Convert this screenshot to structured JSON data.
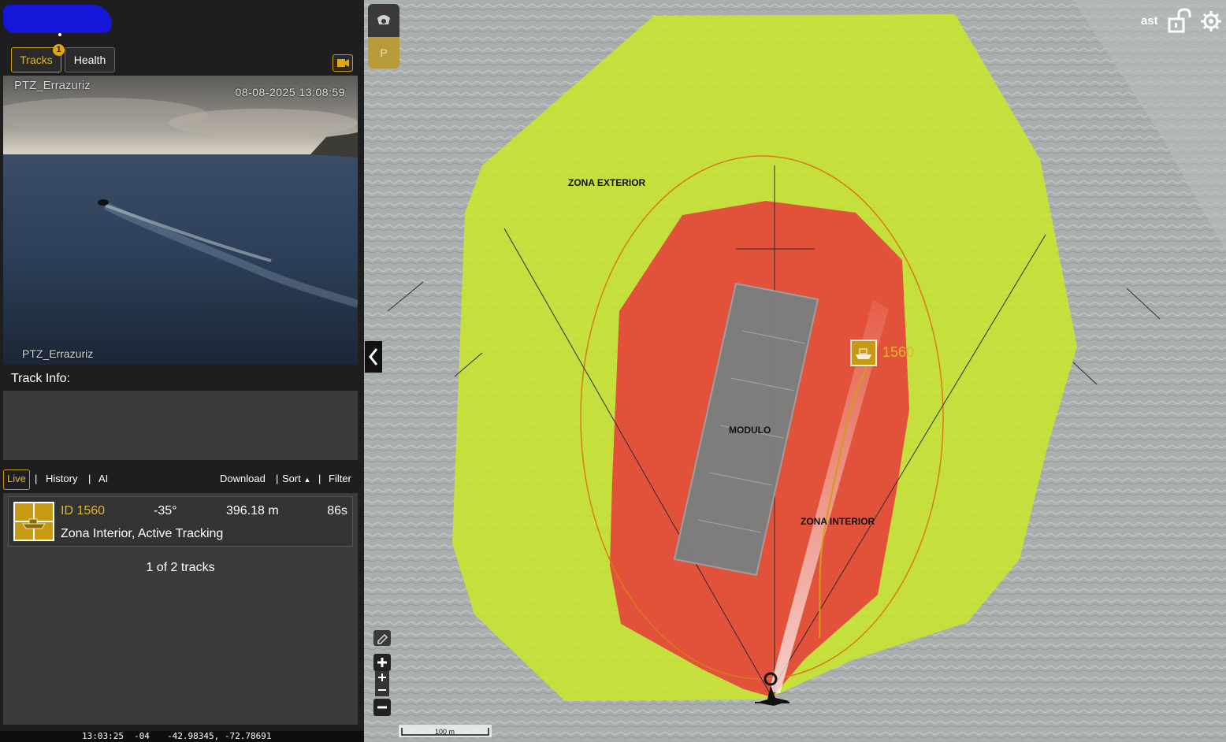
{
  "tabs": {
    "tracks_label": "Tracks",
    "tracks_badge": "1",
    "health_label": "Health"
  },
  "video": {
    "camera_name_top": "PTZ_Errazuriz",
    "timestamp": "08-08-2025 13:08:59",
    "camera_name_bottom": "PTZ_Errazuriz"
  },
  "track_info": {
    "label": "Track Info:"
  },
  "toolbar": {
    "live": "Live",
    "history": "History",
    "ai": "AI",
    "download": "Download",
    "sort": "Sort",
    "filter": "Filter",
    "sep": "|"
  },
  "tracks": [
    {
      "id": "ID 1560",
      "angle": "-35°",
      "distance": "396.18 m",
      "age": "86s",
      "status": "Zona Interior, Active Tracking"
    }
  ],
  "tracks_count": "1 of 2 tracks",
  "status_bar": {
    "time": "13:03:25",
    "tz": "-04",
    "coords": "-42.98345, -72.78691"
  },
  "map": {
    "zone_outer_label": "ZONA EXTERIOR",
    "zone_inner_label": "ZONA INTERIOR",
    "module_label": "MODULO",
    "track_label": "1560",
    "user_label": "ast",
    "parking_label": "P",
    "scale_label": "100 m",
    "colors": {
      "outer_zone": "#c8e62d",
      "inner_zone": "#e8333a",
      "accent": "#c89a14"
    }
  },
  "icons": [
    "camera-icon",
    "boat-icon",
    "chevron-left-icon",
    "lock-open-icon",
    "gear-icon",
    "cctv-icon",
    "parking-icon",
    "zoom-in-icon",
    "zoom-out-icon",
    "edit-icon",
    "sort-up-icon"
  ]
}
